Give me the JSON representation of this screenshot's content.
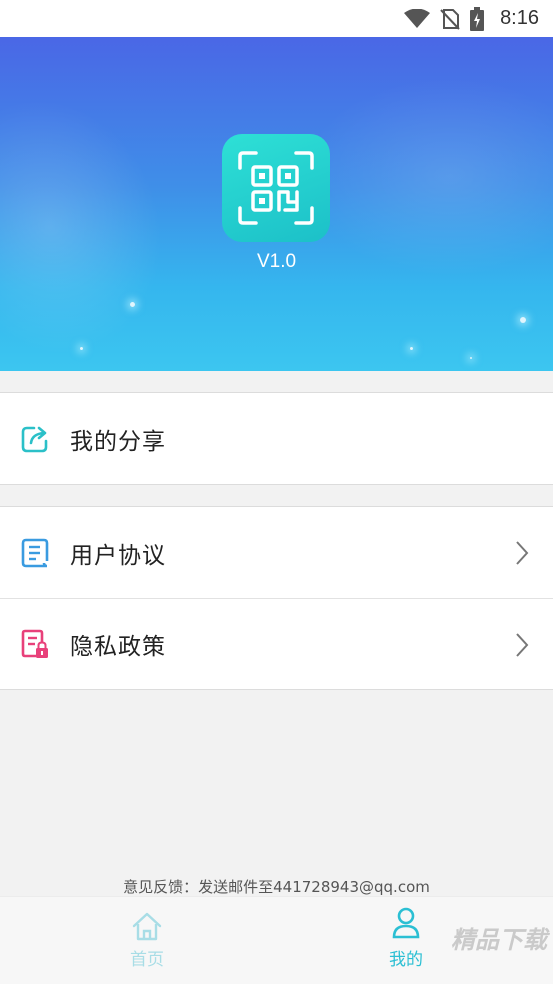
{
  "status_bar": {
    "time": "8:16",
    "icons": [
      "wifi-icon",
      "no-sim-icon",
      "battery-charging-icon"
    ]
  },
  "header": {
    "app_icon": "qr-code-icon",
    "version": "V1.0"
  },
  "menu": {
    "share": {
      "label": "我的分享",
      "icon": "share-icon"
    },
    "user_agreement": {
      "label": "用户协议",
      "icon": "document-icon"
    },
    "privacy_policy": {
      "label": "隐私政策",
      "icon": "privacy-lock-icon"
    }
  },
  "feedback": "意见反馈：发送邮件至441728943@qq.com",
  "tabbar": {
    "home": {
      "label": "首页",
      "icon": "home-icon"
    },
    "mine": {
      "label": "我的",
      "icon": "person-icon",
      "active": true
    }
  },
  "watermark": "精品下载",
  "colors": {
    "accent": "#2bbfd3",
    "header_top": "#4a67e6",
    "header_bottom": "#3cc6f0",
    "privacy_icon": "#e8407a",
    "agreement_icon": "#3a9be0"
  }
}
